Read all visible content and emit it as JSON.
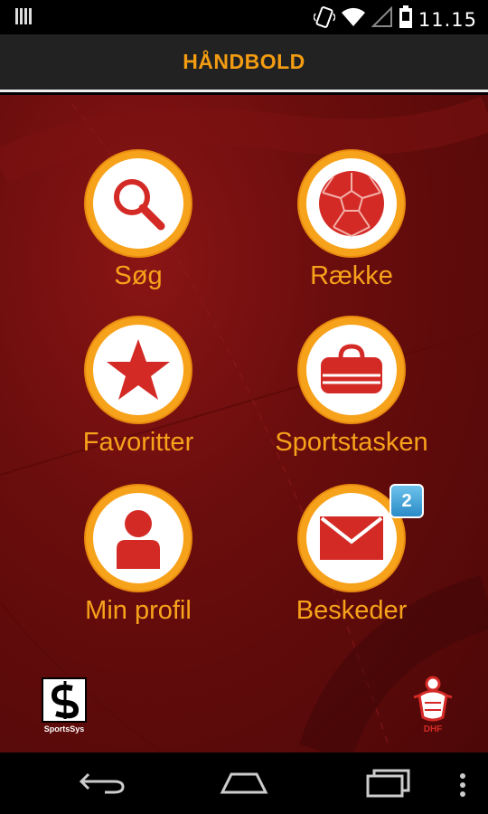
{
  "status_bar": {
    "time": "11.15",
    "icons": [
      "notification-bars-icon",
      "vibrate-icon",
      "wifi-icon",
      "no-signal-icon",
      "battery-icon"
    ]
  },
  "app_bar": {
    "title": "HÅNDBOLD"
  },
  "menu": {
    "items": [
      {
        "label": "Søg",
        "icon": "search-icon"
      },
      {
        "label": "Række",
        "icon": "handball-icon"
      },
      {
        "label": "Favoritter",
        "icon": "star-icon"
      },
      {
        "label": "Sportstasken",
        "icon": "sports-bag-icon"
      },
      {
        "label": "Min profil",
        "icon": "profile-icon"
      },
      {
        "label": "Beskeder",
        "icon": "envelope-icon",
        "badge": "2"
      }
    ]
  },
  "footer": {
    "left_logo_text": "SportsSys",
    "right_logo_text": "DHF"
  },
  "nav_bar": {
    "icons": [
      "back-icon",
      "home-icon",
      "recent-apps-icon",
      "overflow-menu-icon"
    ]
  },
  "colors": {
    "accent": "#f7a21b",
    "icon_red": "#d42a26",
    "background": "#6a0d0d",
    "badge": "#3fa3d9"
  }
}
